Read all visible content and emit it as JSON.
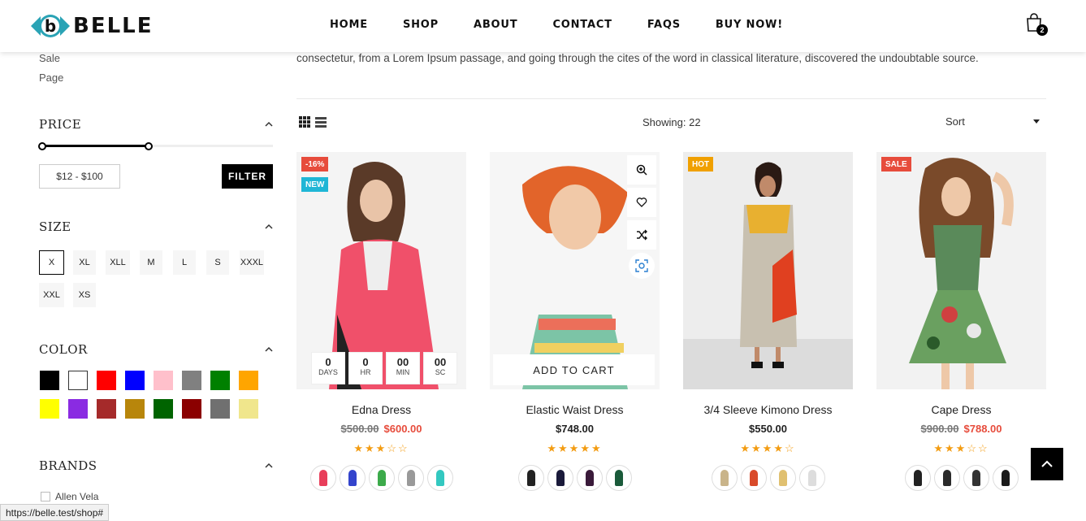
{
  "brand": {
    "name": "BELLE",
    "accent": "#2aa3b5"
  },
  "nav": [
    "HOME",
    "SHOP",
    "ABOUT",
    "CONTACT",
    "FAQS",
    "BUY NOW!"
  ],
  "cart": {
    "count": "2"
  },
  "sidebar": {
    "links": [
      "Sale",
      "Page"
    ],
    "price": {
      "title": "PRICE",
      "range": "$12 - $100",
      "filter_label": "FILTER",
      "min_fraction": 0.0,
      "max_fraction": 0.47
    },
    "size": {
      "title": "SIZE",
      "options": [
        "X",
        "XL",
        "XLL",
        "M",
        "L",
        "S",
        "XXXL",
        "XXL",
        "XS"
      ],
      "selected": "X"
    },
    "color": {
      "title": "COLOR",
      "swatches": [
        "#000000",
        "#ffffff",
        "#ff0000",
        "#0000ff",
        "#ffc0cb",
        "#808080",
        "#008000",
        "#ffa500",
        "#ffff00",
        "#8a2be2",
        "#a52a2a",
        "#b8860b",
        "#006400",
        "#8b0000",
        "#707070",
        "#f0e68c"
      ]
    },
    "brands": {
      "title": "BRANDS",
      "items": [
        "Allen Vela"
      ]
    }
  },
  "intro_text": "consectetur, from a Lorem Ipsum passage, and going through the cites of the word in classical literature, discovered the undoubtable source.",
  "toolbar": {
    "showing": "Showing: 22",
    "sort": "Sort"
  },
  "products": [
    {
      "name": "Edna Dress",
      "old_price": "$500.00",
      "price": "$600.00",
      "rating": 3,
      "badges": [
        {
          "text": "-16%",
          "color": "#e74c3c"
        },
        {
          "text": "NEW",
          "color": "#1fb6d6"
        }
      ],
      "countdown": [
        {
          "value": "0",
          "unit": "DAYS"
        },
        {
          "value": "0",
          "unit": "HR"
        },
        {
          "value": "00",
          "unit": "MIN"
        },
        {
          "value": "00",
          "unit": "SC"
        }
      ],
      "variants": [
        "#e83e5a",
        "#3344cc",
        "#3caa4a",
        "#999999",
        "#33c8c0",
        "#f08a30"
      ]
    },
    {
      "name": "Elastic Waist Dress",
      "old_price": "",
      "price": "$748.00",
      "rating": 5,
      "badges": [],
      "add_to_cart": "ADD TO CART",
      "variants": [
        "#222222",
        "#1a1a3a",
        "#3a1a3a",
        "#1a5a3a"
      ]
    },
    {
      "name": "3/4 Sleeve Kimono Dress",
      "old_price": "",
      "price": "$550.00",
      "rating": 4,
      "badges": [
        {
          "text": "HOT",
          "color": "#f0a000"
        }
      ],
      "variants": [
        "#c9b48a",
        "#d94a2a",
        "#e0c070",
        "#dddddd"
      ]
    },
    {
      "name": "Cape Dress",
      "old_price": "$900.00",
      "price": "$788.00",
      "rating": 3,
      "badges": [
        {
          "text": "SALE",
          "color": "#e74c3c"
        }
      ],
      "variants": [
        "#222222",
        "#2a2a2a",
        "#333333",
        "#1a1a1a"
      ]
    }
  ],
  "status_url": "https://belle.test/shop#"
}
